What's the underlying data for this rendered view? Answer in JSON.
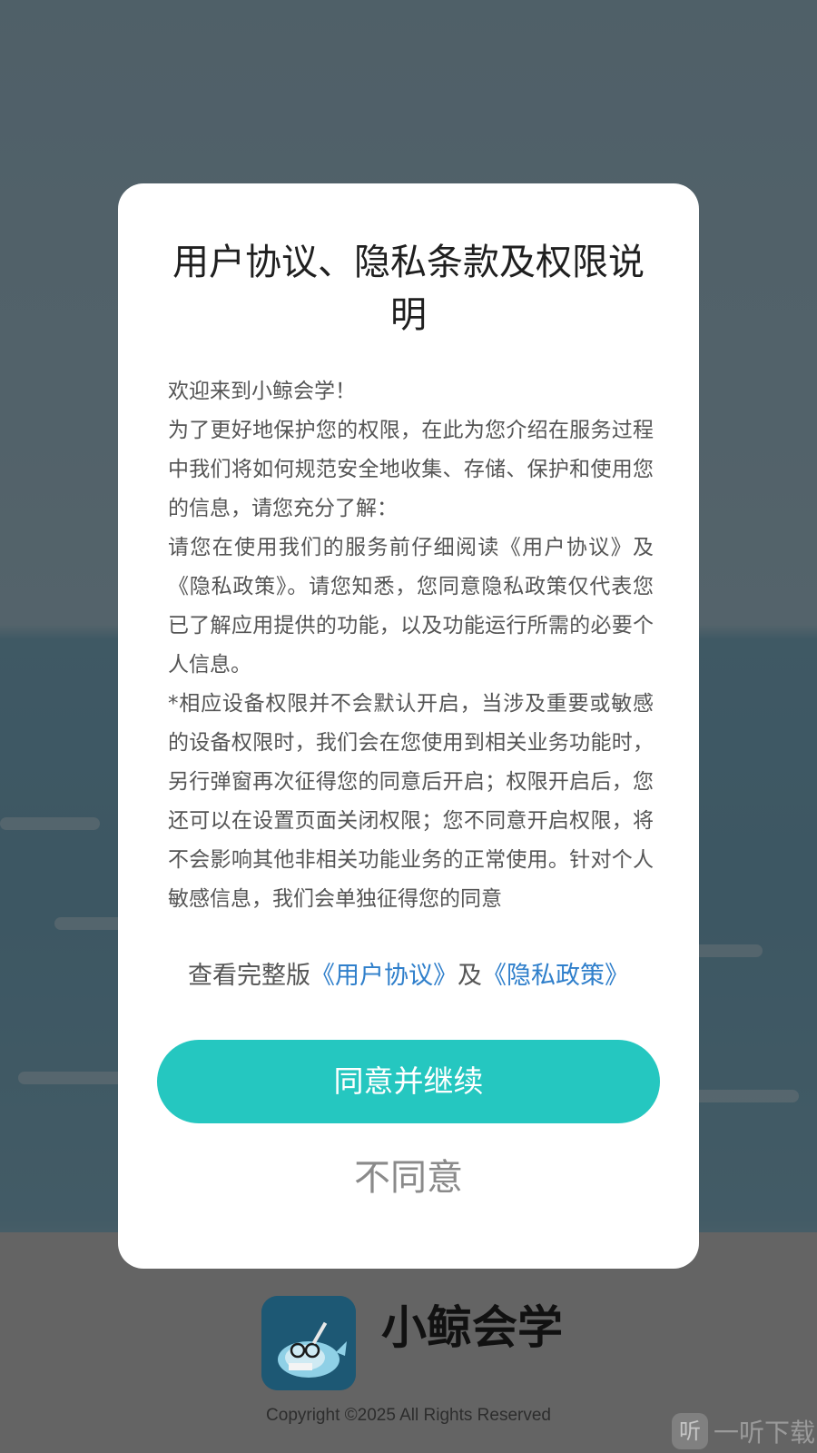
{
  "dialog": {
    "title": "用户协议、隐私条款及权限说明",
    "paragraphs": [
      "欢迎来到小鲸会学！",
      "为了更好地保护您的权限，在此为您介绍在服务过程中我们将如何规范安全地收集、存储、保护和使用您的信息，请您充分了解：",
      "请您在使用我们的服务前仔细阅读《用户协议》及《隐私政策》。请您知悉，您同意隐私政策仅代表您已了解应用提供的功能，以及功能运行所需的必要个人信息。",
      "*相应设备权限并不会默认开启，当涉及重要或敏感的设备权限时，我们会在您使用到相关业务功能时，另行弹窗再次征得您的同意后开启；权限开启后，您还可以在设置页面关闭权限；您不同意开启权限，将不会影响其他非相关功能业务的正常使用。针对个人敏感信息，我们会单独征得您的同意"
    ],
    "links_prefix": "查看完整版",
    "user_agreement_link": "《用户协议》",
    "links_joiner": "及",
    "privacy_policy_link": "《隐私政策》",
    "agree_button": "同意并继续",
    "disagree_button": "不同意"
  },
  "footer": {
    "app_name": "小鲸会学",
    "copyright": "Copyright ©2025 All Rights Reserved",
    "logo_icon": "whale-logo-icon"
  },
  "watermark": {
    "icon_glyph": "听",
    "text": "一听下载"
  },
  "colors": {
    "accent": "#25c7c0",
    "link": "#2f7fcb",
    "dialog_bg": "#ffffff",
    "overlay": "rgba(0,0,0,0.5)"
  }
}
